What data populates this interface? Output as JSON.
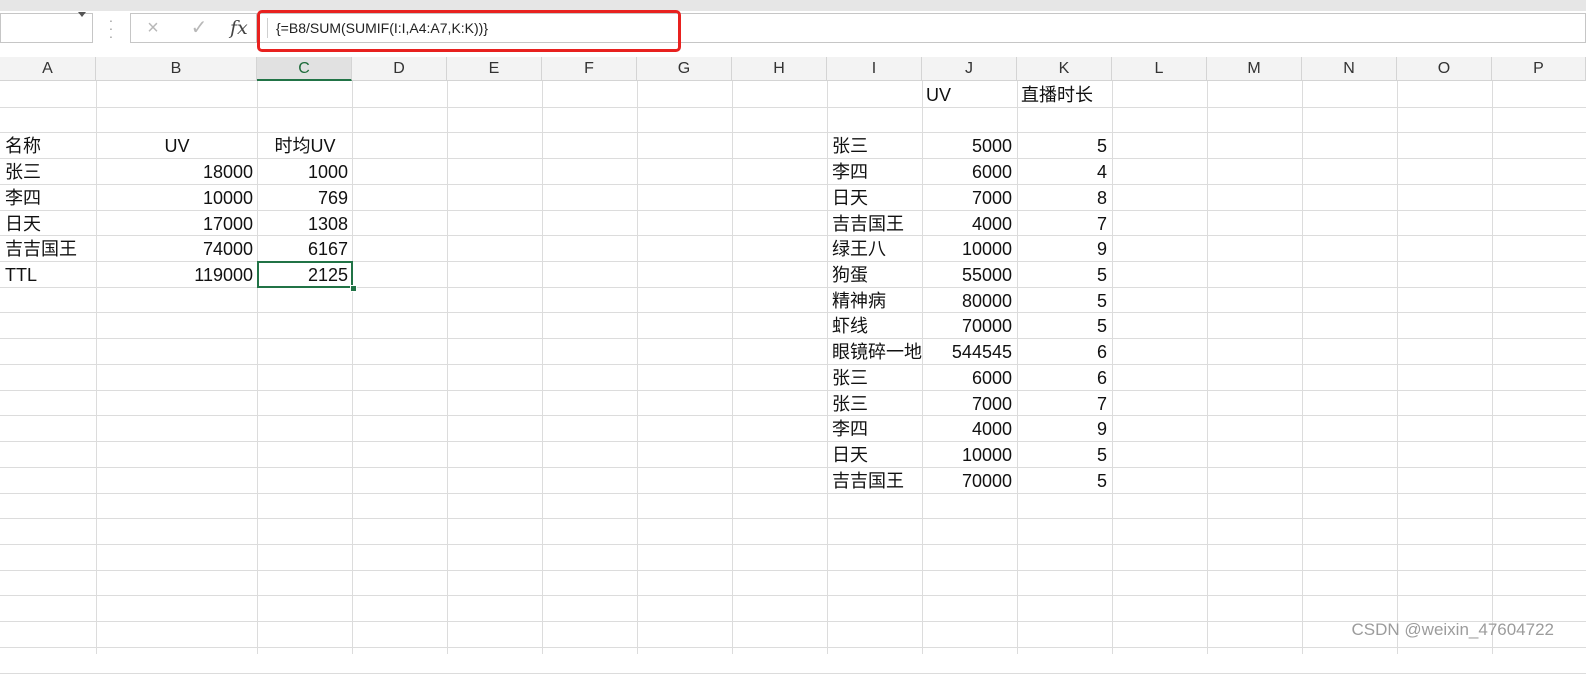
{
  "formula_bar": {
    "name_box": "",
    "cancel_icon": "×",
    "enter_icon": "✓",
    "fx_label": "fx",
    "formula": "{=B8/SUM(SUMIF(I:I,A4:A7,K:K))}"
  },
  "accent_colors": {
    "highlight": "#e8211f",
    "selection": "#217346"
  },
  "columns": [
    "A",
    "B",
    "C",
    "D",
    "E",
    "F",
    "G",
    "H",
    "I",
    "J",
    "K",
    "L",
    "M",
    "N",
    "O",
    "P"
  ],
  "active_column": "C",
  "left_table": {
    "headers": {
      "name": "名称",
      "uv": "UV",
      "hourly_uv": "时均UV"
    },
    "rows": [
      {
        "name": "张三",
        "uv": "18000",
        "hourly_uv": "1000"
      },
      {
        "name": "李四",
        "uv": "10000",
        "hourly_uv": "769"
      },
      {
        "name": "日天",
        "uv": "17000",
        "hourly_uv": "1308"
      },
      {
        "name": "吉吉国王",
        "uv": "74000",
        "hourly_uv": "6167"
      },
      {
        "name": "TTL",
        "uv": "119000",
        "hourly_uv": "2125"
      }
    ]
  },
  "right_table": {
    "headers": {
      "uv": "UV",
      "duration": "直播时长"
    },
    "rows": [
      {
        "name": "张三",
        "uv": "5000",
        "duration": "5"
      },
      {
        "name": "李四",
        "uv": "6000",
        "duration": "4"
      },
      {
        "name": "日天",
        "uv": "7000",
        "duration": "8"
      },
      {
        "name": "吉吉国王",
        "uv": "4000",
        "duration": "7"
      },
      {
        "name": "绿王八",
        "uv": "10000",
        "duration": "9"
      },
      {
        "name": "狗蛋",
        "uv": "55000",
        "duration": "5"
      },
      {
        "name": "精神病",
        "uv": "80000",
        "duration": "5"
      },
      {
        "name": "虾线",
        "uv": "70000",
        "duration": "5"
      },
      {
        "name": "眼镜碎一地",
        "uv": "544545",
        "duration": "6"
      },
      {
        "name": "张三",
        "uv": "6000",
        "duration": "6"
      },
      {
        "name": "张三",
        "uv": "7000",
        "duration": "7"
      },
      {
        "name": "李四",
        "uv": "4000",
        "duration": "9"
      },
      {
        "name": "日天",
        "uv": "10000",
        "duration": "5"
      },
      {
        "name": "吉吉国王",
        "uv": "70000",
        "duration": "5"
      }
    ]
  },
  "watermark": "CSDN @weixin_47604722"
}
